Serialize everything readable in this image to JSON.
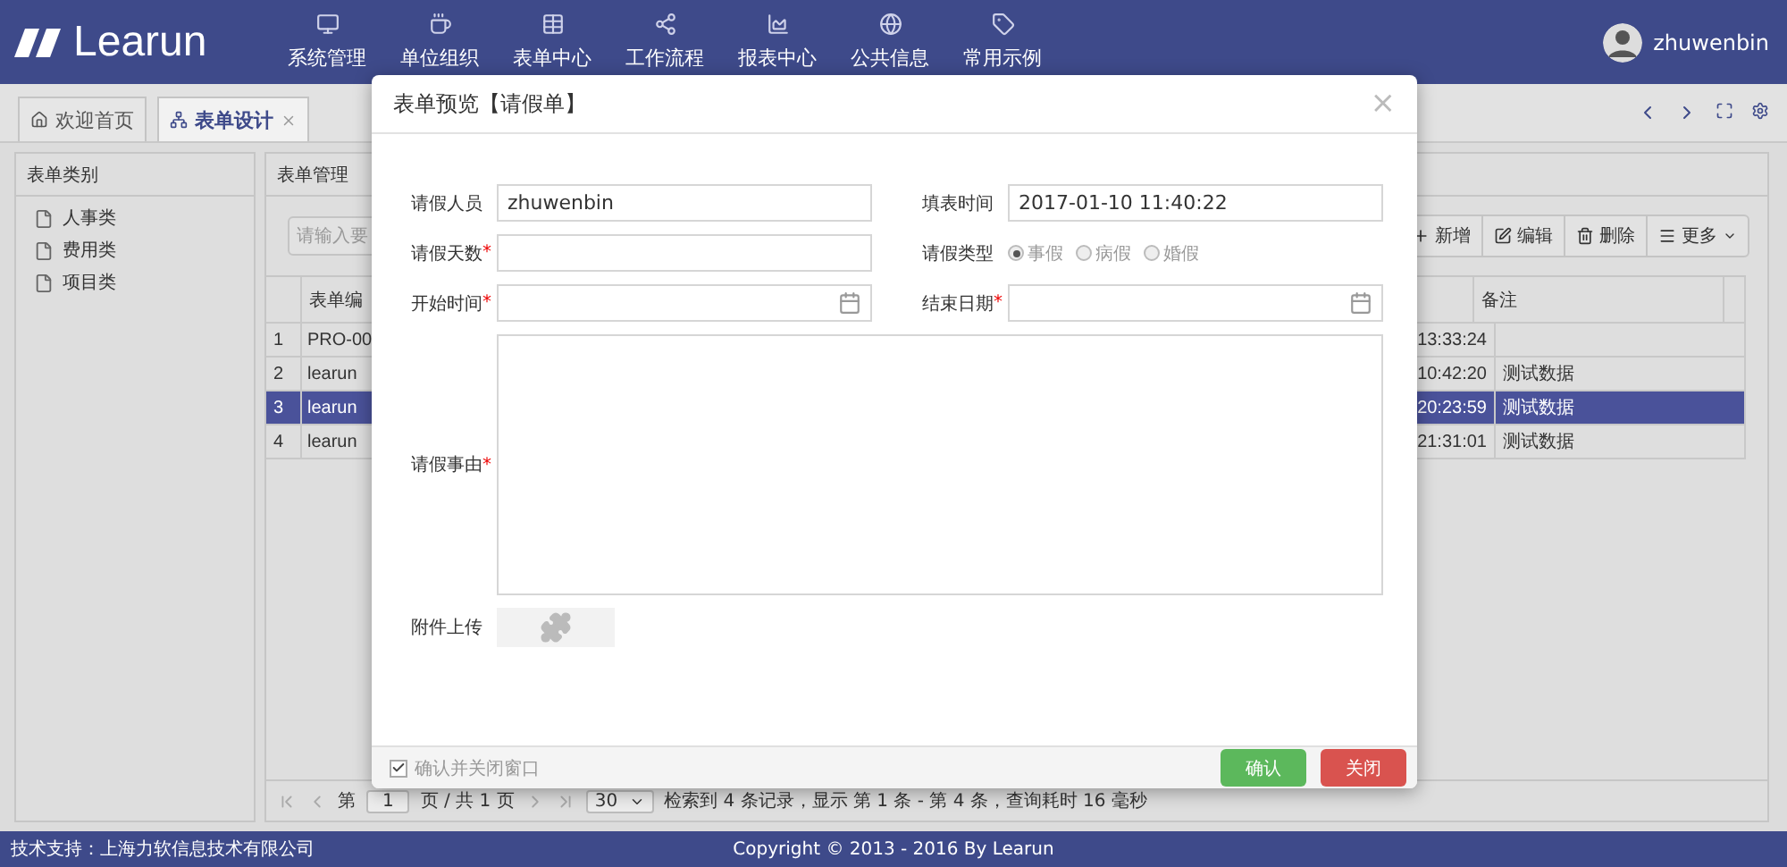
{
  "header": {
    "logo": "Learun",
    "nav": [
      {
        "label": "系统管理"
      },
      {
        "label": "单位组织"
      },
      {
        "label": "表单中心"
      },
      {
        "label": "工作流程"
      },
      {
        "label": "报表中心"
      },
      {
        "label": "公共信息"
      },
      {
        "label": "常用示例"
      }
    ],
    "user": "zhuwenbin"
  },
  "tabs": [
    {
      "label": "欢迎首页",
      "selected": false,
      "closable": false
    },
    {
      "label": "表单设计",
      "selected": true,
      "closable": true
    }
  ],
  "left_panel": {
    "title": "表单类别",
    "items": [
      {
        "label": "人事类"
      },
      {
        "label": "费用类"
      },
      {
        "label": "项目类"
      }
    ]
  },
  "grid_panel": {
    "title": "表单管理",
    "search_placeholder": "请输入要",
    "toolbar": [
      {
        "label": "新增"
      },
      {
        "label": "编辑"
      },
      {
        "label": "删除"
      },
      {
        "label": "更多"
      }
    ],
    "columns": [
      "表单编",
      "备注"
    ],
    "rows": [
      {
        "number": "1",
        "code": "PRO-00",
        "time": "13:33:24",
        "note": "",
        "selected": false
      },
      {
        "number": "2",
        "code": "learun",
        "time": "10:42:20",
        "note": "测试数据",
        "selected": false
      },
      {
        "number": "3",
        "code": "learun",
        "time": "20:23:59",
        "note": "测试数据",
        "selected": true
      },
      {
        "number": "4",
        "code": "learun",
        "time": "21:31:01",
        "note": "测试数据",
        "selected": false
      }
    ],
    "pager": {
      "before": "第",
      "page": "1",
      "after": "页 / 共 1 页",
      "page_size": "30",
      "summary": "检索到 4 条记录，显示 第 1 条 - 第 4 条，查询耗时 16 毫秒"
    }
  },
  "modal": {
    "title": "表单预览【请假单】",
    "close": "×",
    "fields": [
      {
        "kind": "text",
        "label": "请假人员",
        "value": "zhuwenbin"
      },
      {
        "kind": "text",
        "label": "填表时间",
        "value": "2017-01-10 11:40:22"
      },
      {
        "kind": "text",
        "label": "请假天数",
        "required_mark": "*"
      },
      {
        "kind": "radio",
        "label": "请假类型",
        "options": [
          {
            "label": "事假",
            "selected": true
          },
          {
            "label": "病假",
            "selected": false
          },
          {
            "label": "婚假",
            "selected": false
          }
        ]
      },
      {
        "kind": "date",
        "label": "开始时间",
        "required_mark": "*"
      },
      {
        "kind": "date",
        "label": "结束日期",
        "required_mark": "*"
      },
      {
        "kind": "textarea",
        "label": "请假事由",
        "required_mark": "*"
      },
      {
        "kind": "upload",
        "label": "附件上传"
      }
    ],
    "footer": {
      "checkbox": {
        "label": "确认并关闭窗口",
        "checked": true
      },
      "buttons": [
        {
          "kind": "confirm",
          "label": "确认"
        },
        {
          "kind": "close",
          "label": "关闭"
        }
      ]
    }
  },
  "footer": {
    "support": "技术支持：上海力软信息技术有限公司",
    "copyright": "Copyright © 2013 - 2016 By Learun"
  }
}
